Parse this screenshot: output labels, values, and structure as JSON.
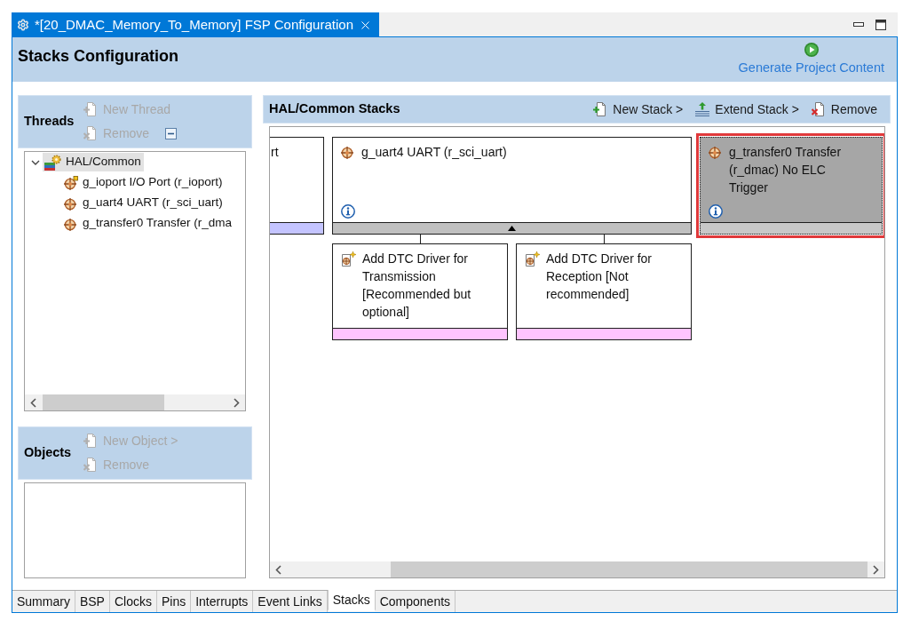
{
  "editor_tab": {
    "title": "*[20_DMAC_Memory_To_Memory] FSP Configuration"
  },
  "header": {
    "title": "Stacks Configuration",
    "action": "Generate Project Content"
  },
  "threads": {
    "title": "Threads",
    "actions": [
      {
        "label": "New Thread",
        "kind": "new",
        "disabled": true
      },
      {
        "label": "Remove",
        "kind": "remove",
        "disabled": true
      }
    ],
    "tree": [
      {
        "label": "HAL/Common",
        "kind": "group",
        "selected": true,
        "expanded": true,
        "children": [
          {
            "label": "g_ioport I/O Port (r_ioport)",
            "kind": "flagged_module",
            "selected": false
          },
          {
            "label": "g_uart4 UART (r_sci_uart)",
            "kind": "module",
            "selected": false
          },
          {
            "label": "g_transfer0 Transfer (r_dma",
            "kind": "module",
            "selected": false
          }
        ]
      }
    ]
  },
  "objects": {
    "title": "Objects",
    "actions": [
      {
        "label": "New Object >",
        "kind": "new",
        "disabled": true
      },
      {
        "label": "Remove",
        "kind": "remove",
        "disabled": true
      }
    ]
  },
  "stacks": {
    "title": "HAL/Common Stacks",
    "actions": [
      {
        "label": "New Stack >",
        "kind": "new",
        "disabled": false
      },
      {
        "label": "Extend Stack >",
        "kind": "extend",
        "disabled": false
      },
      {
        "label": "Remove",
        "kind": "remove",
        "disabled": false
      }
    ],
    "nodes": [
      {
        "kind": "clipped",
        "label": "rt",
        "color": "#c4c4ff",
        "info": false,
        "selected": false
      },
      {
        "kind": "module",
        "label": "g_uart4 UART (r_sci_uart)",
        "color": "#c0c0c0",
        "info": true,
        "selected": false,
        "expanded": true,
        "children": [
          {
            "kind": "suggestion",
            "label": "Add DTC Driver for Transmission [Recommended but optional]",
            "color": "#ffc4ff",
            "info": false,
            "selected": false
          },
          {
            "kind": "suggestion",
            "label": "Add DTC Driver for Reception [Not recommended]",
            "color": "#ffc4ff",
            "info": false,
            "selected": false
          }
        ]
      },
      {
        "kind": "module",
        "label": "g_transfer0 Transfer (r_dmac) No ELC Trigger",
        "color": "#c8c8c8",
        "info": true,
        "selected": true
      }
    ]
  },
  "bottom_tabs": [
    {
      "label": "Summary",
      "selected": false
    },
    {
      "label": "BSP",
      "selected": false
    },
    {
      "label": "Clocks",
      "selected": false
    },
    {
      "label": "Pins",
      "selected": false
    },
    {
      "label": "Interrupts",
      "selected": false
    },
    {
      "label": "Event Links",
      "selected": false
    },
    {
      "label": "Stacks",
      "selected": true
    },
    {
      "label": "Components",
      "selected": false
    }
  ]
}
